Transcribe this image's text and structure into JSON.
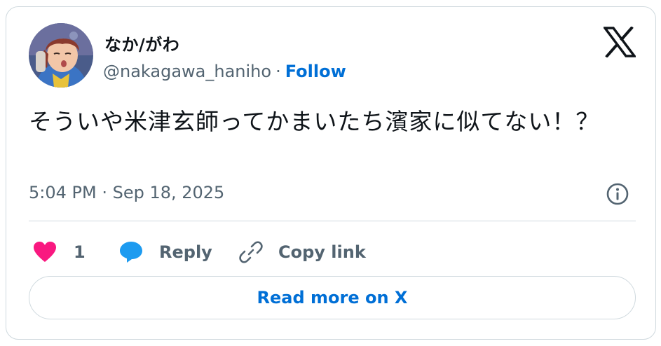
{
  "author": {
    "display_name": "なか/がわ",
    "handle": "@nakagawa_haniho",
    "separator": "·",
    "follow_label": "Follow"
  },
  "tweet": {
    "text": "そういや米津玄師ってかまいたち濱家に似てない！？",
    "timestamp": "5:04 PM · Sep 18, 2025"
  },
  "actions": {
    "like_count": "1",
    "reply_label": "Reply",
    "copy_link_label": "Copy link"
  },
  "read_more_label": "Read more on X",
  "icons": {
    "brand": "x-logo-icon",
    "info": "info-icon",
    "like": "heart-icon",
    "reply": "speech-bubble-icon",
    "copy": "link-icon"
  },
  "colors": {
    "like": "#f91880",
    "reply": "#1d9bf0",
    "link": "#006fd6",
    "secondary_text": "#536471",
    "border": "#cfd9de"
  }
}
